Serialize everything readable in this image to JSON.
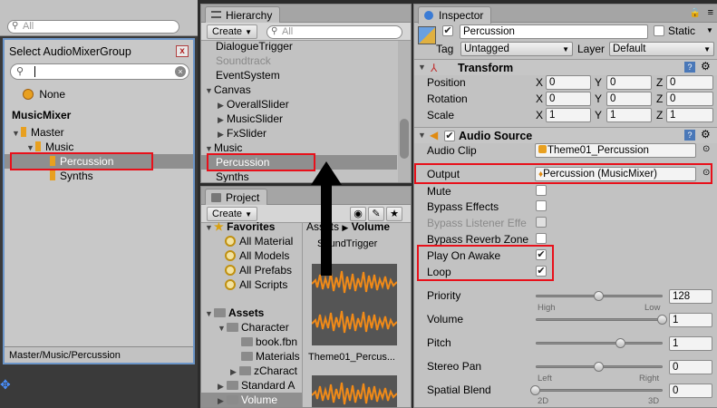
{
  "left_panel": {
    "search_placeholder": "All",
    "title": "Select AudioMixerGroup",
    "close_glyph": "x",
    "none_label": "None",
    "mixer_name": "MusicMixer",
    "items": [
      "Master",
      "Music",
      "Percussion",
      "Synths"
    ],
    "footer": "Master/Music/Percussion"
  },
  "hierarchy": {
    "tab": "Hierarchy",
    "create": "Create",
    "search_placeholder": "All",
    "items": [
      "DialogueTrigger",
      "Soundtrack",
      "EventSystem",
      "Canvas",
      "OverallSlider",
      "MusicSlider",
      "FxSlider",
      "Music",
      "Percussion",
      "Synths"
    ]
  },
  "project": {
    "tab": "Project",
    "create": "Create",
    "favorites": "Favorites",
    "fav_items": [
      "All Material",
      "All Models",
      "All Prefabs",
      "All Scripts"
    ],
    "assets": "Assets",
    "asset_items": [
      "Character",
      "book.fbn",
      "Materials",
      "zCharact",
      "Standard A",
      "Volume"
    ],
    "breadcrumb_1": "Assets",
    "breadcrumb_2": "Volume",
    "sound_trigger": "SoundTrigger",
    "clip_name": "Theme01_Percus..."
  },
  "inspector": {
    "tab": "Inspector",
    "object_name": "Percussion",
    "static_label": "Static",
    "tag_label": "Tag",
    "tag_value": "Untagged",
    "layer_label": "Layer",
    "layer_value": "Default",
    "transform_title": "Transform",
    "position_label": "Position",
    "rotation_label": "Rotation",
    "scale_label": "Scale",
    "axes": [
      "X",
      "Y",
      "Z"
    ],
    "position": [
      "0",
      "0",
      "0"
    ],
    "rotation": [
      "0",
      "0",
      "0"
    ],
    "scale": [
      "1",
      "1",
      "1"
    ],
    "audio_title": "Audio Source",
    "audio_clip_label": "Audio Clip",
    "audio_clip_value": "Theme01_Percussion",
    "output_label": "Output",
    "output_value": "Percussion  (MusicMixer)",
    "mute": "Mute",
    "bypass_effects": "Bypass Effects",
    "bypass_listener": "Bypass Listener Effe",
    "bypass_reverb": "Bypass Reverb Zone",
    "play_on_awake": "Play On Awake",
    "loop": "Loop",
    "priority_label": "Priority",
    "priority_value": "128",
    "priority_high": "High",
    "priority_low": "Low",
    "volume_label": "Volume",
    "volume_value": "1",
    "pitch_label": "Pitch",
    "pitch_value": "1",
    "stereo_label": "Stereo Pan",
    "stereo_value": "0",
    "stereo_left": "Left",
    "stereo_right": "Right",
    "spatial_label": "Spatial Blend",
    "spatial_value": "0",
    "spatial_2d": "2D",
    "spatial_3d": "3D"
  },
  "slider_levels": {
    "priority": 0.5,
    "volume": 1.0,
    "pitch": 0.67,
    "stereo": 0.5,
    "spatial": 0.0
  },
  "colors": {
    "highlight": "#e8101a",
    "arrow": "#000000",
    "waveform": "#f08a18"
  }
}
